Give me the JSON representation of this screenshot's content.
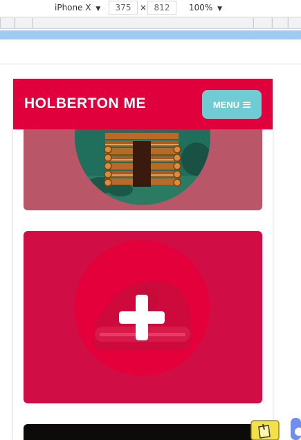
{
  "devtools": {
    "device": "iPhone X",
    "width": "375",
    "height": "812",
    "times": "×",
    "zoom": "100%",
    "dropdown_glyph": "▼"
  },
  "site": {
    "brand": "HOLBERTON ME",
    "menu_label": "MENU",
    "menu_icon": "hamburger-icon"
  },
  "cards": [
    {
      "name": "cabin-project-card",
      "icon": "log-cabin-icon",
      "bg": "#b95667"
    },
    {
      "name": "add-project-card",
      "icon": "plus-icon",
      "bg": "#d00e45"
    },
    {
      "name": "dark-project-card",
      "bg": "#0d0b0a"
    }
  ],
  "colors": {
    "header": "#e0003c",
    "menu_button": "#6fccd3",
    "accent_circle": "#e4003b"
  }
}
